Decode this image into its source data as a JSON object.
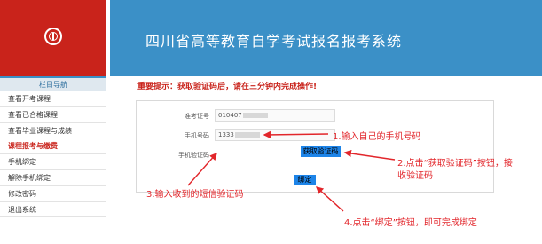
{
  "header": {
    "title": "四川省高等教育自学考试报名报考系统"
  },
  "sidebar": {
    "heading": "栏目导航",
    "items": [
      {
        "label": "查看开考课程"
      },
      {
        "label": "查看已合格课程"
      },
      {
        "label": "查看毕业课程与成绩"
      },
      {
        "label": "课程报考与缴费"
      },
      {
        "label": "手机绑定"
      },
      {
        "label": "解除手机绑定"
      },
      {
        "label": "修改密码"
      },
      {
        "label": "退出系统"
      }
    ]
  },
  "notice": "重要提示：获取验证码后，请在三分钟内完成操作!",
  "form": {
    "exam_id_label": "准考证号",
    "exam_id_value": "010407",
    "phone_label": "手机号码",
    "phone_value": "1333",
    "code_label": "手机验证码",
    "get_code_button": "获取验证码",
    "bind_button": "绑定"
  },
  "annotations": {
    "step1": "1.输入自己的手机号码",
    "step2_line1": "2.点击“获取验证码”按钮，接",
    "step2_line2": "收验证码",
    "step3": "3.输入收到的短信验证码",
    "step4": "4.点击“绑定”按钮，即可完成绑定"
  },
  "colors": {
    "brand_red": "#c9231b",
    "header_blue": "#3b90c7",
    "button_blue": "#1d84e8",
    "annotation_red": "#e2262b"
  }
}
